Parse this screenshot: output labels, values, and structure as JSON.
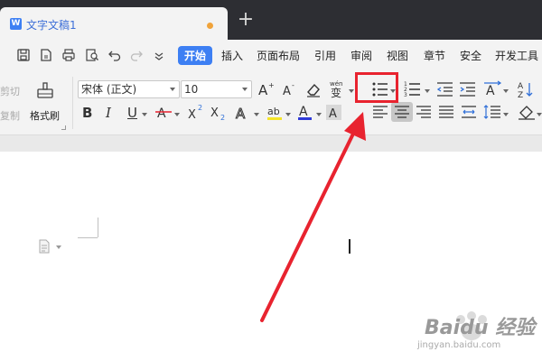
{
  "titlebar": {
    "doc_title": "文字文稿1",
    "accent": "#3d7ff3"
  },
  "menu": {
    "items": [
      {
        "label": "开始",
        "active": true
      },
      {
        "label": "插入"
      },
      {
        "label": "页面布局"
      },
      {
        "label": "引用"
      },
      {
        "label": "审阅"
      },
      {
        "label": "视图"
      },
      {
        "label": "章节"
      },
      {
        "label": "安全"
      },
      {
        "label": "开发工具"
      }
    ]
  },
  "ribbon": {
    "cut_label": "剪切",
    "copy_label": "复制",
    "format_painter_label": "格式刷",
    "font_family": "宋体 (正文)",
    "font_size": "10",
    "pinyin_glyph": "wén",
    "pinyin_char": "变"
  },
  "watermark": {
    "brand": "Baidu 经验",
    "url": "jingyan.baidu.com"
  },
  "annotation": {
    "color": "#e8232f"
  }
}
